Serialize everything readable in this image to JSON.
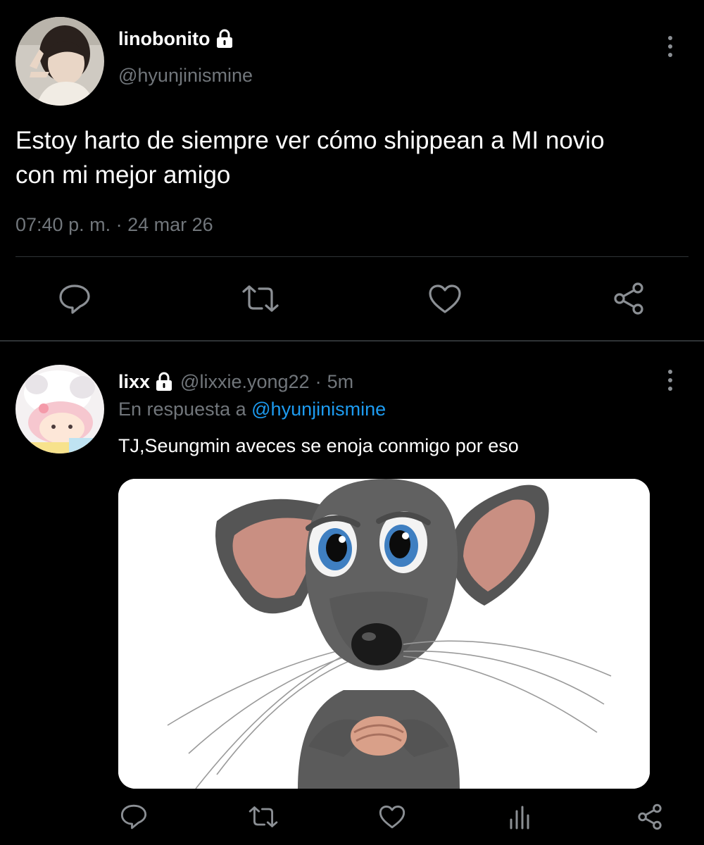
{
  "tweet": {
    "display_name": "linobonito",
    "handle": "@hyunjinismine",
    "text_line1": "Estoy harto de siempre ver cómo shippean a MI novio",
    "text_line2": "con mi mejor amigo",
    "timestamp": "07:40 p. m. · 24 mar 26",
    "icons": [
      "lock-icon",
      "more-icon",
      "reply-icon",
      "retweet-icon",
      "like-icon",
      "share-icon"
    ]
  },
  "reply": {
    "display_name": "lixx",
    "handle": "@lixxie.yong22",
    "separator": "·",
    "time": "5m",
    "in_reply_prefix": "En respuesta a",
    "in_reply_handle": "@hyunjinismine",
    "text": "TJ,Seungmin aveces se enoja conmigo por eso",
    "icons": [
      "lock-icon",
      "more-icon",
      "reply-icon",
      "retweet-icon",
      "like-icon",
      "analytics-icon",
      "share-icon"
    ]
  },
  "colors": {
    "background": "#000000",
    "text": "#e7e9ea",
    "muted": "#71767b",
    "link": "#1d9bf0",
    "divider": "#2f3336"
  }
}
